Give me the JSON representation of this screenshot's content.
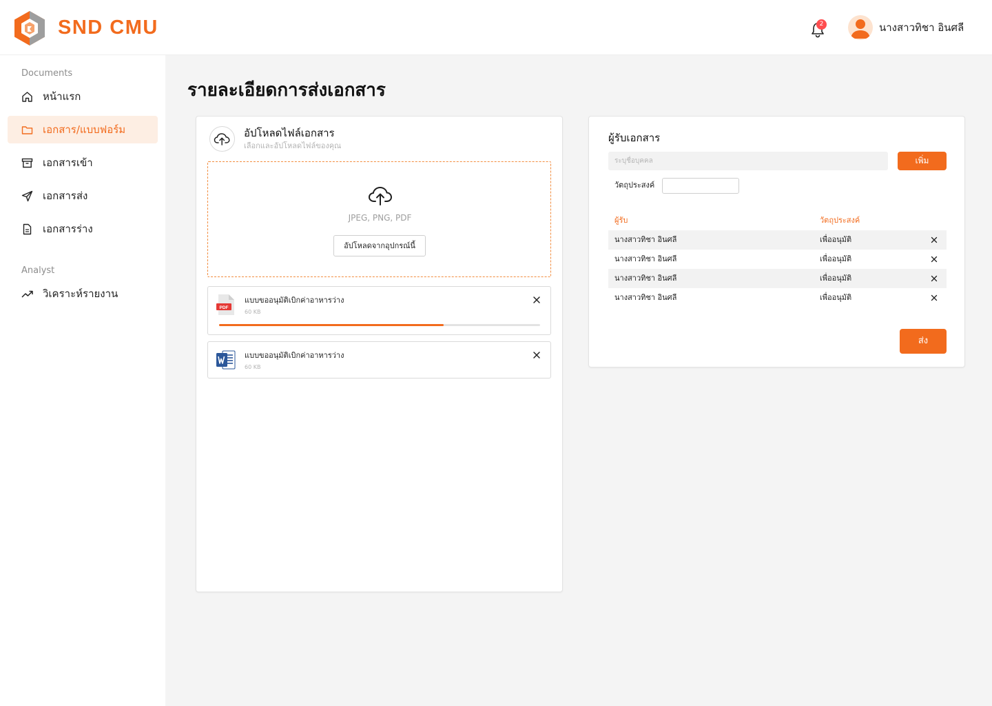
{
  "app": {
    "brand": "SND CMU",
    "notification_count": "2",
    "user_name": "นางสาวทิชา อินศลี"
  },
  "sidebar": {
    "sections": [
      {
        "title": "Documents",
        "items": [
          {
            "label": "หน้าแรก",
            "icon": "home-icon",
            "active": false
          },
          {
            "label": "เอกสาร/แบบฟอร์ม",
            "icon": "folder-icon",
            "active": true
          },
          {
            "label": "เอกสารเข้า",
            "icon": "inbox-icon",
            "active": false
          },
          {
            "label": "เอกสารส่ง",
            "icon": "send-icon",
            "active": false
          },
          {
            "label": "เอกสารร่าง",
            "icon": "draft-document-icon",
            "active": false
          }
        ]
      },
      {
        "title": "Analyst",
        "items": [
          {
            "label": "วิเคราะห์รายงาน",
            "icon": "trending-up-icon",
            "active": false
          }
        ]
      }
    ]
  },
  "page": {
    "title": "รายละเอียดการส่งเอกสาร"
  },
  "upload": {
    "title": "อัปโหลดไฟล์เอกสาร",
    "subtitle": "เลือกและอัปโหลดไฟล์ของคุณ",
    "accepted_types": "JPEG, PNG, PDF",
    "button_label": "อัปโหลดจากอุปกรณ์นี้",
    "files": [
      {
        "name": "แบบขออนุมัติเบิกค่าอาหารว่าง",
        "size": "60 KB",
        "type": "pdf",
        "progress": 0.7
      },
      {
        "name": "แบบขออนุมัติเบิกค่าอาหารว่าง",
        "size": "60 KB",
        "type": "word"
      }
    ]
  },
  "recipients": {
    "title": "ผู้รับเอกสาร",
    "input_placeholder": "ระบุชื่อบุคคล",
    "add_label": "เพิ่ม",
    "purpose_label": "วัตถุประสงค์",
    "columns": [
      "ผู้รับ",
      "วัตถุประสงค์"
    ],
    "rows": [
      {
        "recipient": "นางสาวทิชา อินศลี",
        "purpose": "เพื่ออนุมัติ"
      },
      {
        "recipient": "นางสาวทิชา อินศลี",
        "purpose": "เพื่ออนุมัติ"
      },
      {
        "recipient": "นางสาวทิชา อินศลี",
        "purpose": "เพื่ออนุมัติ"
      },
      {
        "recipient": "นางสาวทิชา อินศลี",
        "purpose": "เพื่ออนุมัติ"
      }
    ],
    "send_label": "ส่ง"
  },
  "colors": {
    "accent": "#f26b1d",
    "accent_light": "#fdeee3",
    "background": "#f4f4f4"
  }
}
